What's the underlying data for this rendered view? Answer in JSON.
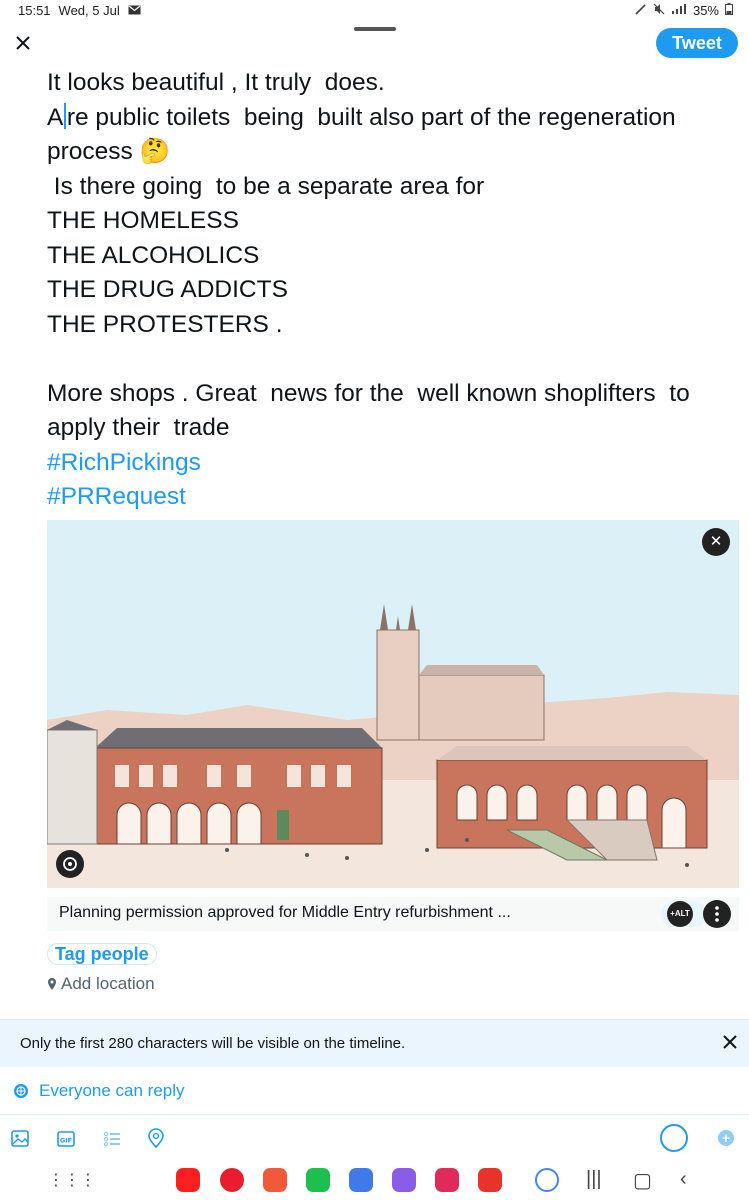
{
  "status": {
    "time": "15:51",
    "date": "Wed, 5 Jul",
    "battery": "35%"
  },
  "header": {
    "tweet_label": "Tweet"
  },
  "compose": {
    "lines": [
      "It looks beautiful , It truly  does.",
      "Are public toilets  being  built also part of the regeneration",
      "process",
      " Is there going  to be a separate area for",
      "THE HOMELESS",
      "THE ALCOHOLICS",
      "THE DRUG ADDICTS",
      "THE PROTESTERS .",
      "",
      "More shops . Great  news for the  well known shoplifters  to",
      "apply their  trade"
    ],
    "hashtags": [
      "#RichPickings",
      "#PRRequest"
    ],
    "emoji": "🤔"
  },
  "media": {
    "remove_label": "✕"
  },
  "link_card": {
    "title": "Planning permission approved for Middle Entry refurbishment ...",
    "alt_label": "+ALT"
  },
  "tag_people_label": "Tag people",
  "add_location_label": "Add location",
  "banner": {
    "text": "Only the first 280 characters will be visible on the timeline."
  },
  "reply": {
    "label": "Everyone can reply"
  },
  "toolbar": {
    "icons": [
      "image-icon",
      "gif-icon",
      "poll-icon",
      "location-icon"
    ]
  },
  "colors": {
    "accent": "#1d9bf0",
    "text": "#0f1419",
    "banner": "#ebf5fd"
  }
}
